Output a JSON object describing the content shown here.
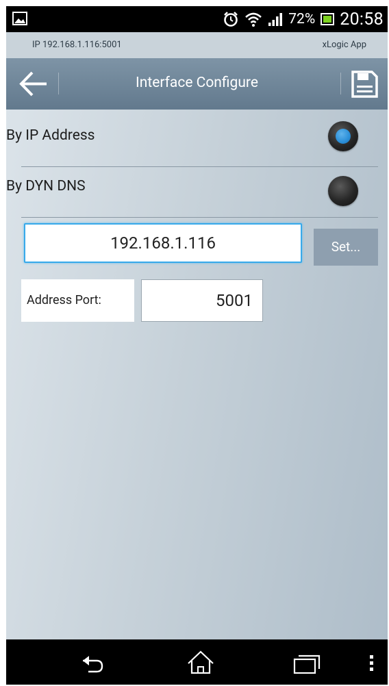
{
  "status_bar": {
    "icons": [
      "picture-icon",
      "alarm-icon",
      "wifi-icon",
      "signal-icon",
      "battery-icon"
    ],
    "battery_percent": "72%",
    "clock": "20:58"
  },
  "info_bar": {
    "connection": "IP 192.168.1.116:5001",
    "app_name": "xLogic App"
  },
  "action_bar": {
    "back_icon": "arrow-left-icon",
    "title": "Interface Configure",
    "save_icon": "floppy-disk-icon"
  },
  "options": {
    "by_ip": {
      "label": "By IP Address",
      "selected": true
    },
    "by_dns": {
      "label": "By DYN DNS",
      "selected": false
    }
  },
  "address": {
    "value": "192.168.1.116",
    "set_label": "Set..."
  },
  "port": {
    "label": "Address Port:",
    "value": "5001"
  },
  "nav_bar": {
    "icons": [
      "back-icon",
      "home-icon",
      "recent-apps-icon",
      "overflow-menu-icon"
    ]
  },
  "colors": {
    "accent": "#37a9ea",
    "action_bar": "#6f869a",
    "radio_selected": "#2b8fd8"
  }
}
